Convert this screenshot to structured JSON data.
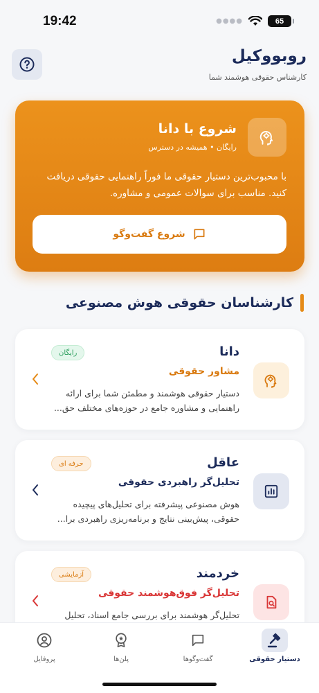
{
  "status_bar": {
    "time": "19:42",
    "battery": "65"
  },
  "header": {
    "title": "روبووکیل",
    "subtitle": "کارشناس حقوقی هوشمند شما",
    "help_icon": "question-circle-icon"
  },
  "hero": {
    "title": "شروع با دانا",
    "subtitle": "رایگان • همیشه در دسترس",
    "description": "با محبوب‌ترین دستیار حقوقی ما فوراً راهنمایی حقوقی دریافت کنید. مناسب برای سوالات عمومی و مشاوره.",
    "button_label": "شروع گفت‌وگو",
    "icon": "brain-head-icon",
    "accent_color": "#E58A16"
  },
  "section": {
    "title": "کارشناسان حقوقی هوش مصنوعی"
  },
  "experts": [
    {
      "name": "دانا",
      "role": "مشاور حقوقی",
      "description": "دستیار حقوقی هوشمند و مطمئن شما برای ارائه راهنمایی و مشاوره جامع در حوزه‌های مختلف حق...",
      "badge": "رایگان",
      "role_color": "#D97A10",
      "icon": "brain-head-icon"
    },
    {
      "name": "عاقل",
      "role": "تحلیل‌گر راهبردی حقوقی",
      "description": "هوش مصنوعی پیشرفته برای تحلیل‌های پیچیده حقوقی، پیش‌بینی نتایج و برنامه‌ریزی راهبردی برا...",
      "badge": "حرفه ای",
      "role_color": "#1C2B5A",
      "icon": "chart-bars-icon"
    },
    {
      "name": "خردمند",
      "role": "تحلیل‌گر فوق‌هوشمند حقوقی",
      "description": "تحلیل‌گر هوشمند برای بررسی جامع اسناد، تحلیل",
      "badge": "آزمایشی",
      "role_color": "#D93636",
      "icon": "document-search-icon"
    }
  ],
  "bottom_nav": [
    {
      "label": "دستیار حقوقی",
      "icon": "gavel-icon",
      "active": true
    },
    {
      "label": "گفت‌وگوها",
      "icon": "chat-icon",
      "active": false
    },
    {
      "label": "پلن‌ها",
      "icon": "award-icon",
      "active": false
    },
    {
      "label": "پروفایل",
      "icon": "user-circle-icon",
      "active": false
    }
  ]
}
